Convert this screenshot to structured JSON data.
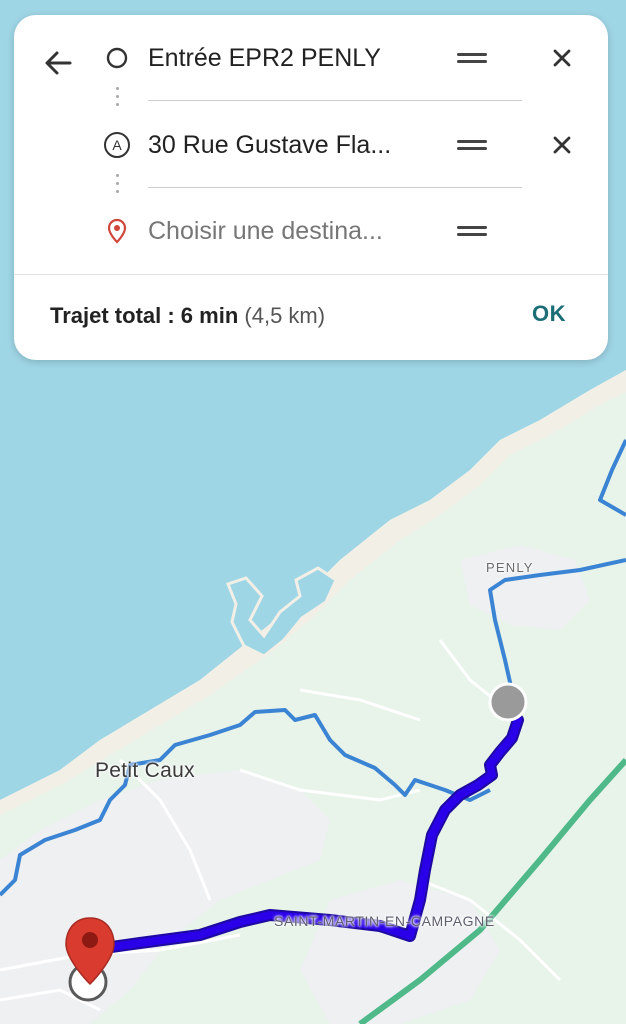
{
  "directions": {
    "origin": {
      "value": "Entrée EPR2 PENLY"
    },
    "stop": {
      "value": "30 Rue Gustave Fla...",
      "marker_letter": "A"
    },
    "destination": {
      "placeholder": "Choisir une destina..."
    },
    "summary": {
      "label": "Trajet total : ",
      "duration": "6 min",
      "distance": "(4,5 km)"
    },
    "ok_label": "OK"
  },
  "map": {
    "labels": {
      "petit_caux": "Petit Caux",
      "penly": "PENLY",
      "saint_martin": "SAINT-MARTIN-EN-CAMPAGNE"
    },
    "colors": {
      "sea": "#9fd6e6",
      "land": "#e8f3ea",
      "route_active": "#2a00e8",
      "route_alt": "#3b84d4",
      "highway": "#4fb98a",
      "pin": "#d93b2f"
    }
  }
}
